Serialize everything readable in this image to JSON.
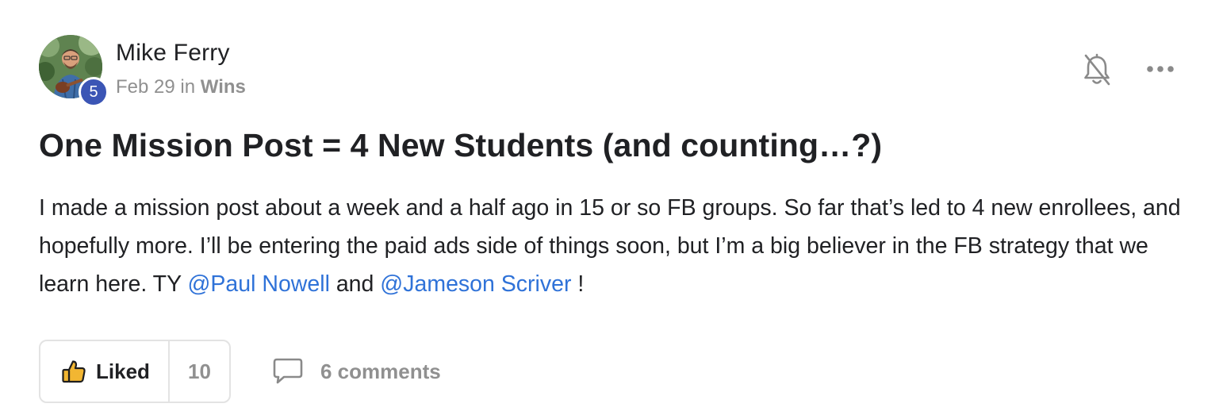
{
  "post": {
    "author": {
      "name": "Mike Ferry",
      "level": "5"
    },
    "meta": {
      "date": "Feb 29",
      "in_label": "in",
      "category": "Wins"
    },
    "title": "One Mission Post = 4 New Students (and counting…?)",
    "body": {
      "text_before": "I made a mission post about a week and a half ago in 15 or so FB groups. So far that’s led to 4 new enrollees, and hopefully more. I’ll be entering the paid ads side of things soon, but I’m a big believer in the FB strategy that we learn here. TY ",
      "mention_1": "@Paul Nowell",
      "text_between": " and ",
      "mention_2": "@Jameson Scriver",
      "text_after": " !"
    },
    "actions": {
      "like_label": "Liked",
      "like_count": "10",
      "comments_label": "6 comments"
    },
    "icons": {
      "notification": "bell-off-icon",
      "more": "more-horizontal-icon",
      "like": "thumbs-up-icon",
      "comment": "comment-icon"
    },
    "colors": {
      "mention": "#2f72d8",
      "level_badge": "#3b55b5",
      "like_icon": "#f2b632",
      "muted": "#909090"
    }
  }
}
